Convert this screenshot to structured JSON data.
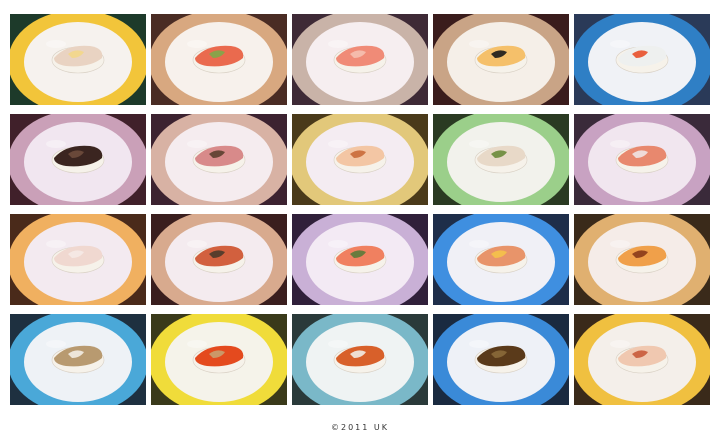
{
  "caption": "©2011 UK",
  "tiles": [
    {
      "name": "tile-r1c1",
      "bg": "#1d3a2a",
      "plate_edge": "#f2c53a",
      "plate": "#f6f2ee",
      "food": "white-fish-with-lemon",
      "food_colors": [
        "#e9d3c2",
        "#f3d78a"
      ]
    },
    {
      "name": "tile-r1c2",
      "bg": "#4a2c24",
      "plate_edge": "#d8a880",
      "plate": "#f7f1ec",
      "food": "salmon-with-sprouts",
      "food_colors": [
        "#ea6a4e",
        "#7fa84a"
      ]
    },
    {
      "name": "tile-r1c3",
      "bg": "#3e2a36",
      "plate_edge": "#c9b3a8",
      "plate": "#f6eef0",
      "food": "salmon-slices",
      "food_colors": [
        "#f08b77",
        "#f5c0b0"
      ]
    },
    {
      "name": "tile-r1c4",
      "bg": "#3a1c1c",
      "plate_edge": "#c9a486",
      "plate": "#f5efe8",
      "food": "tamago-nigiri",
      "food_colors": [
        "#f5c06a",
        "#1a1a1a"
      ]
    },
    {
      "name": "tile-r1c5",
      "bg": "#2a3a58",
      "plate_edge": "#2f7fc5",
      "plate": "#f0f2f6",
      "food": "white-fish-with-roe",
      "food_colors": [
        "#eef0ef",
        "#e8502a"
      ]
    },
    {
      "name": "tile-r2c1",
      "bg": "#40202a",
      "plate_edge": "#caa0b8",
      "plate": "#f1e6f0",
      "food": "seared-fish-gunkan",
      "food_colors": [
        "#3b2520",
        "#6f4d3c"
      ]
    },
    {
      "name": "tile-r2c2",
      "bg": "#3c2230",
      "plate_edge": "#d8b2a4",
      "plate": "#f5ecef",
      "food": "seared-tuna-with-sprouts",
      "food_colors": [
        "#d88a8a",
        "#5c3e2e"
      ]
    },
    {
      "name": "tile-r2c3",
      "bg": "#4a3a1a",
      "plate_edge": "#e2c87a",
      "plate": "#f4ecf2",
      "food": "shrimp-nigiri",
      "food_colors": [
        "#f3c6a4",
        "#c96a3a"
      ]
    },
    {
      "name": "tile-r2c4",
      "bg": "#2a3a22",
      "plate_edge": "#9bcf8a",
      "plate": "#f2f2ec",
      "food": "scallop-nigiri",
      "food_colors": [
        "#e8d9c8",
        "#6a8a3a"
      ]
    },
    {
      "name": "tile-r2c5",
      "bg": "#3a2a3a",
      "plate_edge": "#c8a2c2",
      "plate": "#f1e6ef",
      "food": "salmon-roll",
      "food_colors": [
        "#e8886e",
        "#f0e4e4"
      ]
    },
    {
      "name": "tile-r3c1",
      "bg": "#4a2a1a",
      "plate_edge": "#f0b060",
      "plate": "#f3eaf0",
      "food": "white-fish-nigiri",
      "food_colors": [
        "#f0d8d0",
        "#f5eae6"
      ]
    },
    {
      "name": "tile-r3c2",
      "bg": "#3a1e1e",
      "plate_edge": "#d8aa8e",
      "plate": "#f4ebef",
      "food": "seared-salmon-with-sprouts",
      "food_colors": [
        "#d2603e",
        "#4a3a2a"
      ]
    },
    {
      "name": "tile-r3c3",
      "bg": "#30203a",
      "plate_edge": "#c9b0d6",
      "plate": "#f3eaf4",
      "food": "salmon-with-sprouts-small",
      "food_colors": [
        "#f08060",
        "#5a7a3a"
      ]
    },
    {
      "name": "tile-r3c4",
      "bg": "#1e2e4a",
      "plate_edge": "#3f8fe0",
      "plate": "#f0f0f6",
      "food": "seared-salmon-with-mayo",
      "food_colors": [
        "#e8946a",
        "#f5c24a"
      ]
    },
    {
      "name": "tile-r3c5",
      "bg": "#3a2a1a",
      "plate_edge": "#e0b070",
      "plate": "#f5ece8",
      "food": "salmon-roll-with-sauce",
      "food_colors": [
        "#f0a04a",
        "#8a3a1a"
      ]
    },
    {
      "name": "tile-r4c1",
      "bg": "#1e3040",
      "plate_edge": "#4aa8d8",
      "plate": "#eef2f6",
      "food": "seared-mackerel-nigiri",
      "food_colors": [
        "#b89a70",
        "#f3ede4"
      ]
    },
    {
      "name": "tile-r4c2",
      "bg": "#3a3a1a",
      "plate_edge": "#f0dc3a",
      "plate": "#f5f3ea",
      "food": "roe-gunkan-and-crab",
      "food_colors": [
        "#e44a1e",
        "#c8a070"
      ]
    },
    {
      "name": "tile-r4c3",
      "bg": "#2a3a3a",
      "plate_edge": "#7ab8c8",
      "plate": "#eff3f3",
      "food": "mixed-nigiri-pair",
      "food_colors": [
        "#d8602a",
        "#f2ece4"
      ]
    },
    {
      "name": "tile-r4c4",
      "bg": "#1a2a40",
      "plate_edge": "#3a8ad8",
      "plate": "#eef1f7",
      "food": "grilled-eel-nigiri",
      "food_colors": [
        "#5a3a1a",
        "#8a6a3a"
      ]
    },
    {
      "name": "tile-r4c5",
      "bg": "#3a2a1a",
      "plate_edge": "#f0c040",
      "plate": "#f4efea",
      "food": "crab-nigiri",
      "food_colors": [
        "#f0c8b0",
        "#c85a3a"
      ]
    }
  ]
}
